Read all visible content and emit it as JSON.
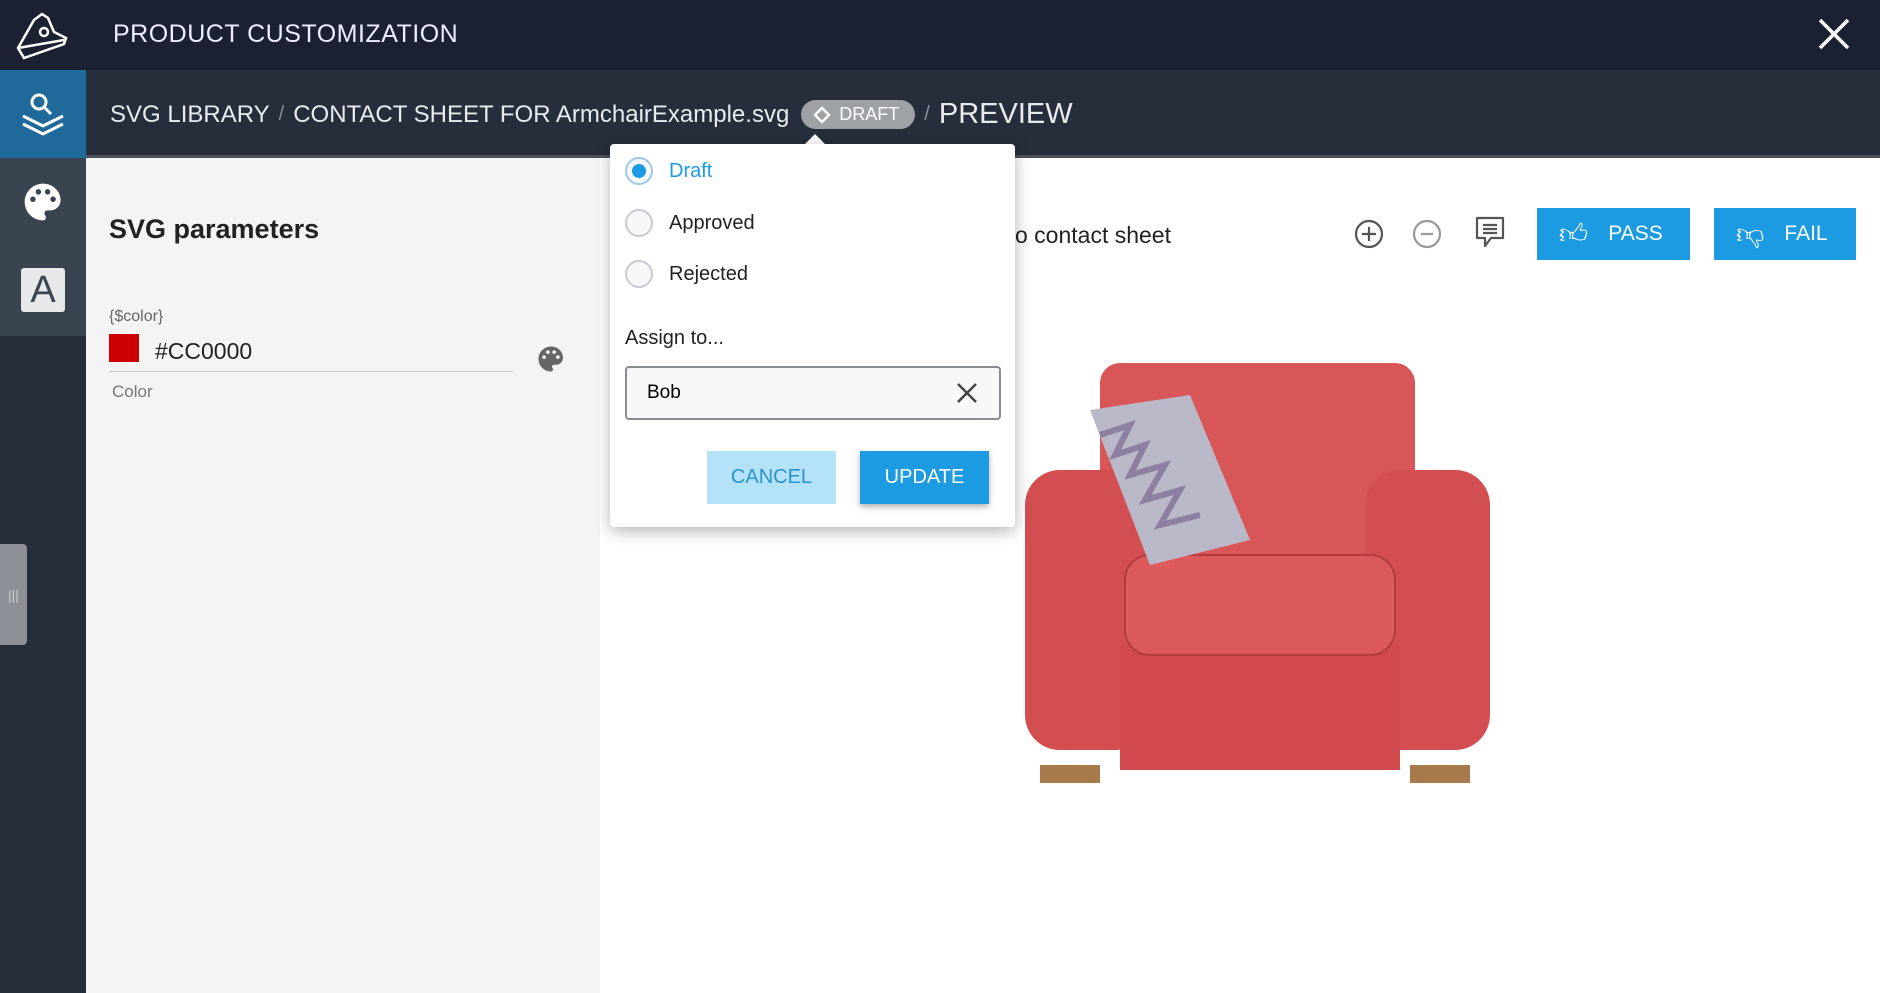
{
  "header": {
    "title": "PRODUCT CUSTOMIZATION",
    "logo": "sneaker-logo",
    "close_icon": "close-icon"
  },
  "breadcrumb": {
    "items": [
      "SVG LIBRARY",
      "CONTACT SHEET FOR ArmchairExample.svg"
    ],
    "separator": "/",
    "status_badge": "DRAFT",
    "current": "PREVIEW"
  },
  "sidebar": {
    "items": [
      {
        "icon": "layers-search-icon",
        "active": true
      },
      {
        "icon": "palette-icon"
      },
      {
        "icon": "text-icon",
        "glyph": "A"
      }
    ]
  },
  "left_panel": {
    "title": "SVG parameters",
    "param": {
      "label": "{$color}",
      "value": "#CC0000",
      "help": "Color"
    }
  },
  "main": {
    "text": "o contact sheet",
    "pass_label": "PASS",
    "fail_label": "FAIL"
  },
  "popup": {
    "options": [
      "Draft",
      "Approved",
      "Rejected"
    ],
    "selected": "Draft",
    "assign_label": "Assign to...",
    "assign_value": "Bob",
    "cancel_label": "CANCEL",
    "update_label": "UPDATE"
  },
  "colors": {
    "accent": "#1c9be3",
    "topbar": "#1b2130",
    "swatch": "#cc0000"
  }
}
